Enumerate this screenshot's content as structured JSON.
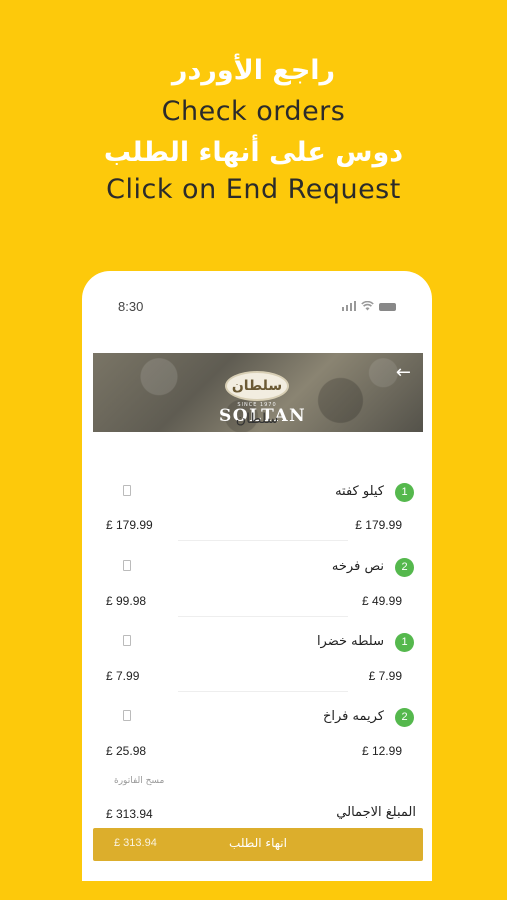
{
  "headline": {
    "arabic_1": "راجع الأوردر",
    "english_1": "Check orders",
    "arabic_2": "دوس على أنهاء الطلب",
    "english_2": "Click on End Request"
  },
  "status_bar": {
    "time": "8:30"
  },
  "restaurant": {
    "logo_text_ar": "سلطان",
    "logo_since": "SINCE 1970",
    "logo_name": "SOLTAN",
    "name": "سلطان"
  },
  "items": [
    {
      "qty": "1",
      "name": "كيلو كفته",
      "unit_price": "£ 179.99",
      "total_price": "£ 179.99"
    },
    {
      "qty": "2",
      "name": "نص فرخه",
      "unit_price": "£ 49.99",
      "total_price": "£ 99.98"
    },
    {
      "qty": "1",
      "name": "سلطه خضرا",
      "unit_price": "£ 7.99",
      "total_price": "£ 7.99"
    },
    {
      "qty": "2",
      "name": "كريمه فراخ",
      "unit_price": "£ 12.99",
      "total_price": "£ 25.98"
    }
  ],
  "clear_bill_label": "مسح الفاتورة",
  "grand_total": {
    "label": "المبلغ الاجمالي",
    "value": "£ 313.94"
  },
  "end_button": {
    "label": "انهاء الطلب",
    "amount": "£ 313.94"
  },
  "colors": {
    "background": "#FDC90B",
    "accent_button": "#DCAE2C",
    "qty_badge": "#55B84D"
  }
}
